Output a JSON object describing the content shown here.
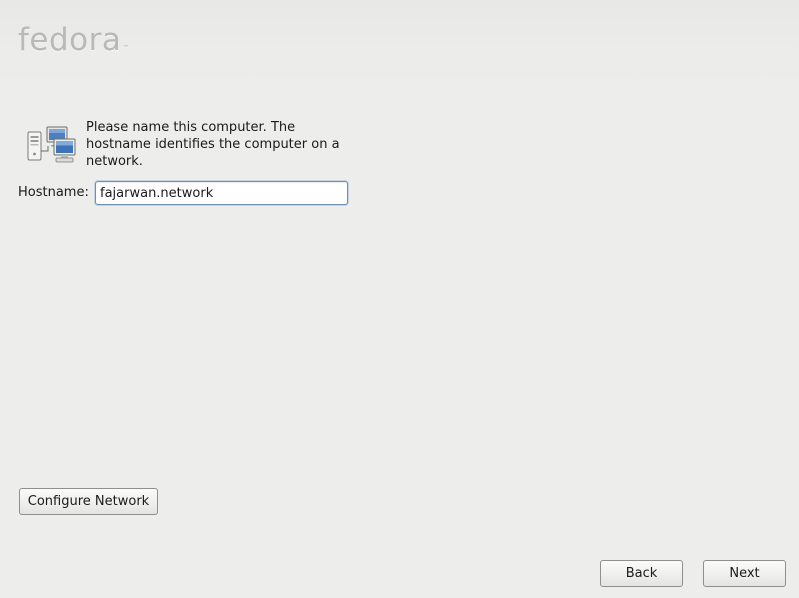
{
  "header": {
    "logo_text": "fedora",
    "logo_mark": "™"
  },
  "main": {
    "icon": "network-computers-icon",
    "intro_text": "Please name this computer.  The hostname identifies the computer on a network.",
    "hostname_label": "Hostname:",
    "hostname_value": "fajarwan.network"
  },
  "buttons": {
    "configure_network": "Configure Network",
    "back": "Back",
    "next": "Next"
  }
}
